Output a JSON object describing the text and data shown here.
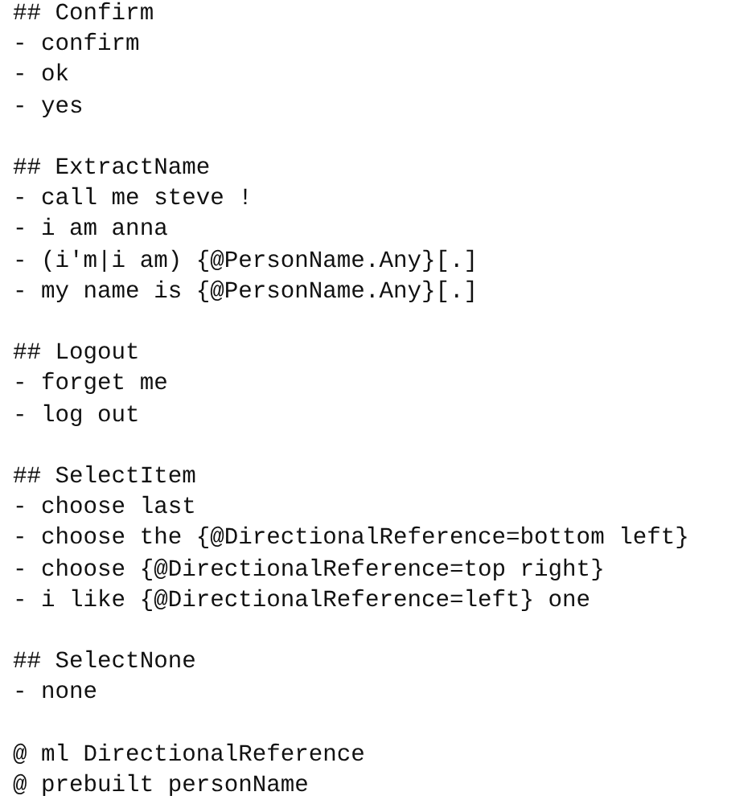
{
  "sections": [
    {
      "heading": "## Confirm",
      "lines": [
        "- confirm",
        "- ok",
        "- yes"
      ]
    },
    {
      "heading": "## ExtractName",
      "lines": [
        "- call me steve !",
        "- i am anna",
        "- (i'm|i am) {@PersonName.Any}[.]",
        "- my name is {@PersonName.Any}[.]"
      ]
    },
    {
      "heading": "## Logout",
      "lines": [
        "- forget me",
        "- log out"
      ]
    },
    {
      "heading": "## SelectItem",
      "lines": [
        "- choose last",
        "- choose the {@DirectionalReference=bottom left}",
        "- choose {@DirectionalReference=top right}",
        "- i like {@DirectionalReference=left} one"
      ]
    },
    {
      "heading": "## SelectNone",
      "lines": [
        "- none"
      ]
    }
  ],
  "entity_lines": [
    "@ ml DirectionalReference",
    "@ prebuilt personName"
  ]
}
